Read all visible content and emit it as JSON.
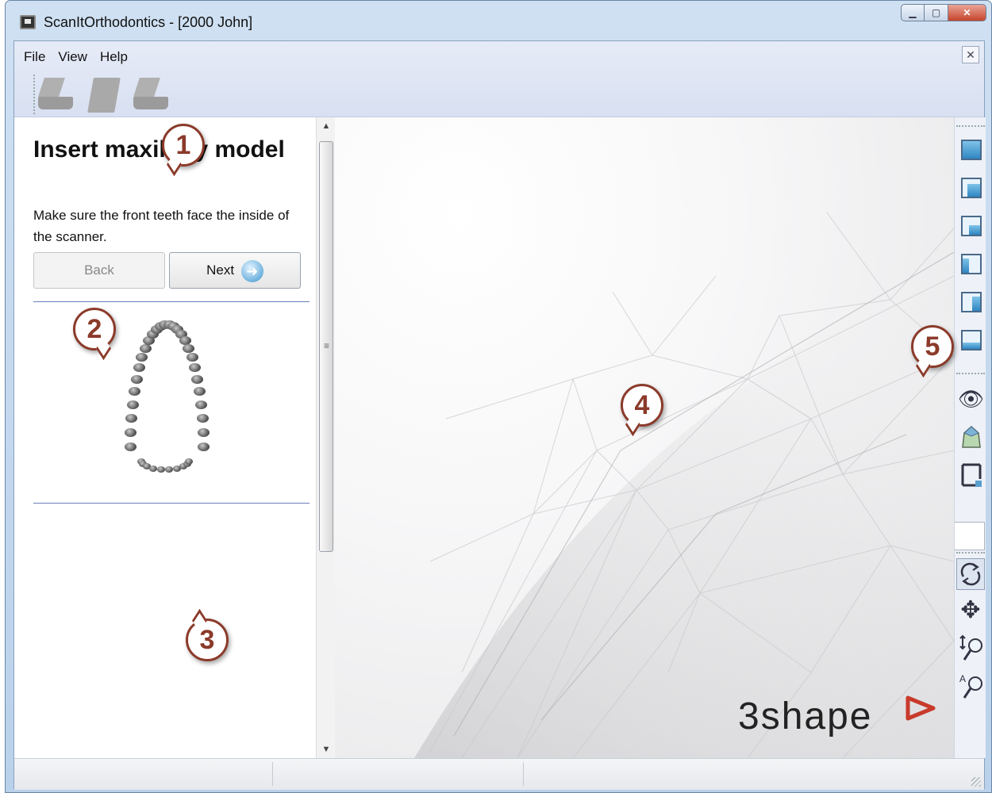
{
  "window": {
    "title": "ScanItOrthodontics - [2000 John]",
    "controls": [
      "minimize",
      "maximize",
      "close"
    ]
  },
  "menu": {
    "items": [
      {
        "label": "File"
      },
      {
        "label": "View"
      },
      {
        "label": "Help"
      }
    ]
  },
  "toolbar": {
    "buttons": [
      {
        "icon": "upper-jaw-icon"
      },
      {
        "icon": "jaw-block-icon"
      },
      {
        "icon": "lower-jaw-icon"
      }
    ]
  },
  "left_panel": {
    "title": "Insert maxillary model",
    "instruction": "Make sure the front teeth face the inside of the scanner.",
    "back_label": "Back",
    "next_label": "Next"
  },
  "callouts": {
    "c1": "1",
    "c2": "2",
    "c3": "3",
    "c4": "4",
    "c5": "5"
  },
  "viewport": {
    "brand": "3shape"
  },
  "right_toolbar": {
    "view_buttons": [
      "view-top-icon",
      "view-front-icon",
      "view-back-icon",
      "view-left-icon",
      "view-right-icon",
      "view-bottom-icon"
    ],
    "display_buttons": [
      "eye-icon",
      "model-icon",
      "frame-icon"
    ],
    "nav_buttons": [
      "rotate-icon",
      "pan-icon",
      "zoom-icon",
      "auto-zoom-icon"
    ]
  },
  "colors": {
    "callout_border": "#8b3a2a",
    "accent_blue": "#3f86bd",
    "brand_red": "#c83a2a"
  }
}
